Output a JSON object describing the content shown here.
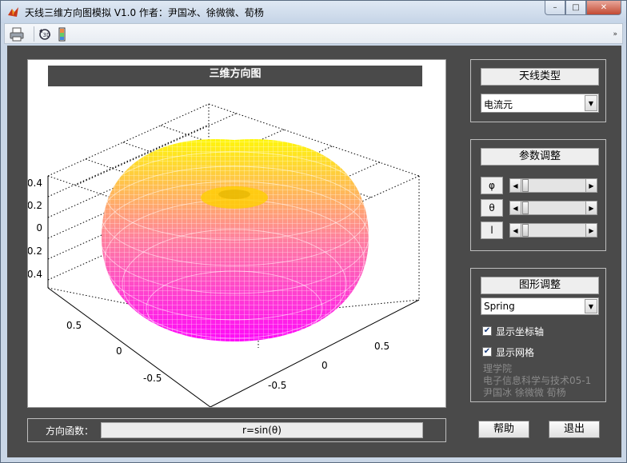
{
  "window": {
    "title": "天线三维方向图模拟 V1.0 作者：尹国冰、徐微微、荀杨",
    "minimize_glyph": "–",
    "maximize_glyph": "□",
    "close_glyph": "✕"
  },
  "toolbar": {
    "icons": [
      "print-icon",
      "rotate-icon",
      "colorbar-icon"
    ],
    "overflow_glyph": "»"
  },
  "plot": {
    "title": "三维方向图",
    "z_ticks": [
      "0.4",
      "0.2",
      "0",
      "-0.2",
      "-0.4"
    ],
    "x_ticks": [
      "0.5",
      "0",
      "-0.5"
    ],
    "y_ticks": [
      "0.5",
      "0",
      "-0.5"
    ],
    "colormap_colors": [
      "#ff00ff",
      "#ffff00"
    ]
  },
  "function_bar": {
    "label": "方向函数：",
    "value": "r=sin(θ)"
  },
  "antenna_panel": {
    "header": "天线类型",
    "selected": "电流元"
  },
  "param_panel": {
    "header": "参数调整",
    "params": [
      {
        "label": "φ",
        "fraction": 0.05
      },
      {
        "label": "θ",
        "fraction": 0.05
      },
      {
        "label": "l",
        "fraction": 0.05
      }
    ]
  },
  "graph_panel": {
    "header": "图形调整",
    "colormap": "Spring",
    "show_axes_label": "显示坐标轴",
    "show_axes_checked": true,
    "show_grid_label": "显示网格",
    "show_grid_checked": true,
    "credits": [
      "理学院",
      "电子信息科学与技术05-1",
      "尹国冰 徐微微 荀杨"
    ]
  },
  "buttons": {
    "help": "帮助",
    "exit": "退出"
  }
}
